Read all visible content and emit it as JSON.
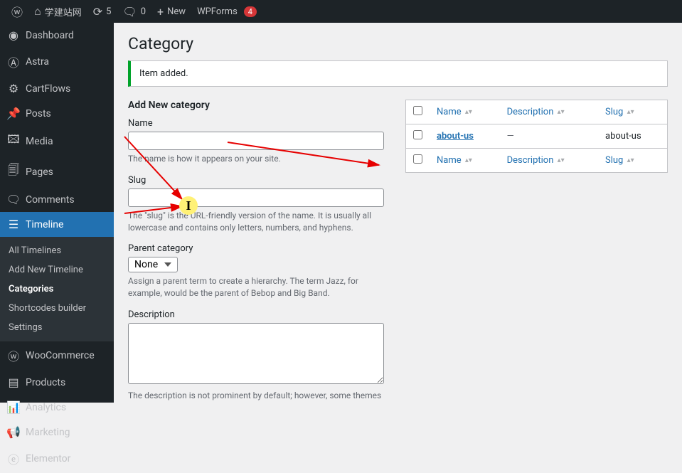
{
  "adminbar": {
    "site_name": "学建站网",
    "updates_count": "5",
    "comments_count": "0",
    "new_label": "New",
    "wpforms_label": "WPForms",
    "wpforms_count": "4"
  },
  "sidebar": {
    "items": [
      {
        "label": "Dashboard",
        "icon": "dashboard"
      },
      {
        "label": "Astra",
        "icon": "astra"
      },
      {
        "label": "CartFlows",
        "icon": "cartflows"
      },
      {
        "label": "Posts",
        "icon": "pin"
      },
      {
        "label": "Media",
        "icon": "media"
      },
      {
        "label": "Pages",
        "icon": "page"
      },
      {
        "label": "Comments",
        "icon": "comment"
      },
      {
        "label": "Timeline",
        "icon": "timeline"
      },
      {
        "label": "WooCommerce",
        "icon": "woo"
      },
      {
        "label": "Products",
        "icon": "products"
      },
      {
        "label": "Analytics",
        "icon": "analytics"
      },
      {
        "label": "Marketing",
        "icon": "marketing"
      },
      {
        "label": "Elementor",
        "icon": "elementor"
      }
    ],
    "timeline_sub": [
      "All Timelines",
      "Add New Timeline",
      "Categories",
      "Shortcodes builder",
      "Settings"
    ]
  },
  "page": {
    "title": "Category",
    "notice": "Item added.",
    "form_heading": "Add New category",
    "name": {
      "label": "Name",
      "help": "The name is how it appears on your site."
    },
    "slug": {
      "label": "Slug",
      "help": "The \"slug\" is the URL-friendly version of the name. It is usually all lowercase and contains only letters, numbers, and hyphens."
    },
    "parent": {
      "label": "Parent category",
      "value": "None",
      "help": "Assign a parent term to create a hierarchy. The term Jazz, for example, would be the parent of Bebop and Big Band."
    },
    "description": {
      "label": "Description",
      "help": "The description is not prominent by default; however, some themes may show it."
    }
  },
  "table": {
    "cols": {
      "name": "Name",
      "description": "Description",
      "slug": "Slug"
    },
    "rows": [
      {
        "name": "about-us",
        "description": "—",
        "slug": "about-us"
      }
    ]
  }
}
